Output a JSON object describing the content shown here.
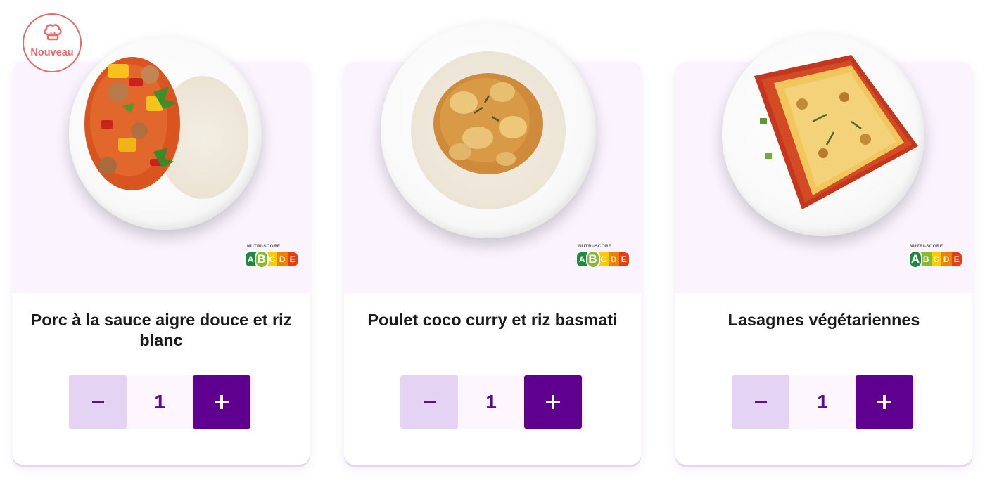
{
  "badge": {
    "label": "Nouveau",
    "icon": "chef-hat-icon",
    "color": "#ea6a6a"
  },
  "nutriscore_label": "NUTRI-SCORE",
  "nutriscore_letters": [
    "A",
    "B",
    "C",
    "D",
    "E"
  ],
  "nutriscore_colors": [
    "#1f8a3f",
    "#85bb2f",
    "#fecb02",
    "#ee8100",
    "#e63e11"
  ],
  "accent_color": "#5f0090",
  "products": [
    {
      "name": "Porc à la sauce aigre douce et riz blanc",
      "nutriscore": "B",
      "quantity": "1"
    },
    {
      "name": "Poulet coco curry et riz basmati",
      "nutriscore": "B",
      "quantity": "1"
    },
    {
      "name": "Lasagnes végétariennes",
      "nutriscore": "A",
      "quantity": "1"
    }
  ],
  "stepper": {
    "minus_icon": "minus-icon",
    "plus_icon": "plus-icon"
  }
}
